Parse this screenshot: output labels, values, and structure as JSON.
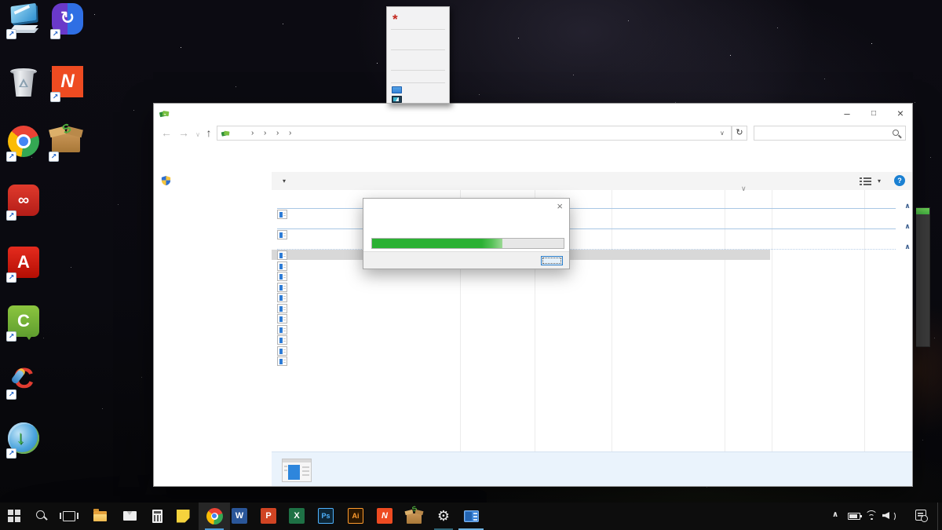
{
  "desktop": {
    "wallpaper_name": "starry-night-sky",
    "icons": [
      {
        "name": "pc-display-app",
        "label": "",
        "shortcut": true
      },
      {
        "name": "file-transfer-app",
        "label": "",
        "shortcut": true,
        "glyph": "↻"
      },
      {
        "name": "recycle-bin",
        "label": "",
        "shortcut": false
      },
      {
        "name": "nitro-pdf",
        "label": "",
        "shortcut": true,
        "glyph": "N"
      },
      {
        "name": "google-chrome",
        "label": "",
        "shortcut": true
      },
      {
        "name": "package-extractor",
        "label": "",
        "shortcut": true,
        "glyph": "S"
      },
      {
        "name": "adobe-creative-cloud",
        "label": "",
        "shortcut": true,
        "glyph": "∞"
      },
      {
        "name": "adobe-acrobat",
        "label": "",
        "shortcut": true,
        "glyph": "A"
      },
      {
        "name": "camtasia",
        "label": "",
        "shortcut": true,
        "glyph": "C"
      },
      {
        "name": "ccleaner",
        "label": "",
        "shortcut": true,
        "glyph": "C"
      },
      {
        "name": "internet-download-manager",
        "label": "",
        "shortcut": true,
        "glyph": "↓"
      }
    ]
  },
  "context_menu": {
    "item_labels": [
      "",
      "",
      "",
      "",
      "",
      "",
      "",
      ""
    ],
    "top_item_icon": "graphics-settings-icon",
    "top_item_glyph": "*",
    "bottom_item_icons": [
      "display-settings-icon",
      "personalize-icon"
    ],
    "separator_count": 4
  },
  "explorer": {
    "title": "",
    "titlebar_icon": "program-transfer-icon",
    "controls": {
      "minimize": "–",
      "maximize": "□",
      "close": "×"
    },
    "nav": {
      "back": "←",
      "forward": "→",
      "history_dropdown": "∨",
      "up": "↑"
    },
    "address": {
      "value": "",
      "crumb_chevron": "›",
      "crumb_count": 4,
      "dropdown": "∨",
      "refresh": "↻"
    },
    "search": {
      "value": "",
      "placeholder": ""
    },
    "command_bar": {
      "menu_dropdown": "▾",
      "view_dropdown": "▾",
      "help_label": "?"
    },
    "left_pane_icon": "uac-shield-icon",
    "list": {
      "sort_chevron": "∨",
      "group_collapse_chevron": "∧",
      "groups": [
        {
          "label": "",
          "item_count": 1
        },
        {
          "label": "",
          "item_count": 1
        },
        {
          "label": "",
          "item_count": 11
        }
      ],
      "selected_row_index": 2,
      "total_rows": 13,
      "row_icon": "default-program-icon"
    },
    "details_pane": {
      "selected_icon": "default-program-icon",
      "text": ""
    }
  },
  "progress_dialog": {
    "title": "",
    "message": "",
    "percent": 68,
    "close": "×",
    "button_label": "",
    "bar_color": "#2bb133"
  },
  "background_window": {
    "body_color": "#3d3d3d",
    "progress_cap_color": "#52c24e"
  },
  "taskbar": {
    "start": {
      "name": "start-button"
    },
    "buttons": [
      {
        "name": "search",
        "running": false
      },
      {
        "name": "task-view",
        "running": false
      },
      {
        "name": "file-explorer",
        "running": false
      },
      {
        "name": "mail",
        "running": false
      },
      {
        "name": "calculator",
        "running": false
      },
      {
        "name": "sticky-notes",
        "running": false
      },
      {
        "name": "google-chrome",
        "running": true,
        "active": true
      },
      {
        "name": "word",
        "glyph": "W",
        "running": false
      },
      {
        "name": "powerpoint",
        "glyph": "P",
        "running": false
      },
      {
        "name": "excel",
        "glyph": "X",
        "running": false
      },
      {
        "name": "photoshop",
        "glyph": "Ps",
        "running": false
      },
      {
        "name": "illustrator",
        "glyph": "Ai",
        "running": false
      },
      {
        "name": "nitro-pdf",
        "glyph": "N",
        "running": false
      },
      {
        "name": "package-extractor",
        "glyph": "S",
        "running": false
      },
      {
        "name": "settings",
        "glyph": "⚙",
        "running": true
      },
      {
        "name": "programs-window",
        "running": true
      }
    ],
    "tray": {
      "expand_glyph": "∧",
      "icons": [
        "battery-icon",
        "wifi-icon",
        "volume-icon"
      ],
      "clock": "",
      "action_center": "action-center-icon"
    }
  },
  "colors": {
    "taskbar": "#0d0d0d",
    "accent": "#0078d7",
    "selection": "#d8d8d8",
    "group_line": "#a9c7e4",
    "progress_green": "#2bb133"
  }
}
